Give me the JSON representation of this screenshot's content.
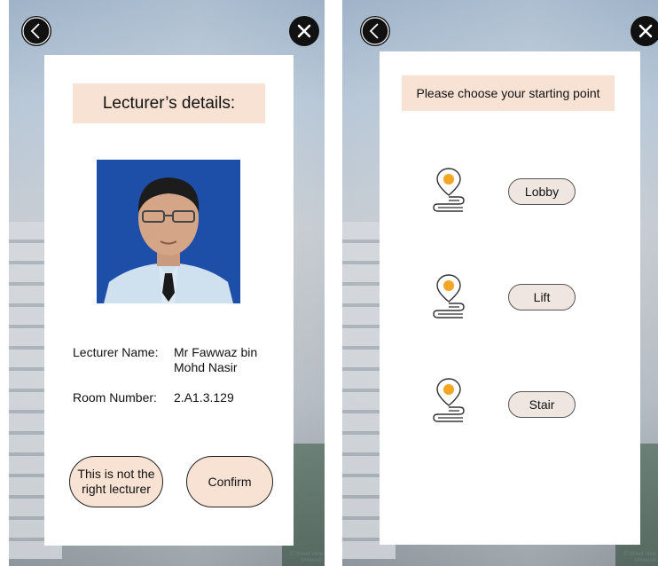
{
  "left_screen": {
    "back_icon": "chevron-left-icon",
    "close_icon": "close-icon",
    "title": "Lecturer’s details:",
    "photo_alt": "lecturer-photo",
    "name_label": "Lecturer Name:",
    "name_value_line1": "Mr Fawwaz bin",
    "name_value_line2": "Mohd Nasir",
    "room_label": "Room Number:",
    "room_value": "2.A1.3.129",
    "not_right_line1": "This is not the",
    "not_right_line2": "right lecturer",
    "confirm_label": "Confirm"
  },
  "right_screen": {
    "back_icon": "chevron-left-icon",
    "close_icon": "close-icon",
    "title": "Please choose your starting point",
    "options": [
      {
        "label": "Lobby",
        "icon": "route-pin-icon"
      },
      {
        "label": "Lift",
        "icon": "route-pin-icon"
      },
      {
        "label": "Stair",
        "icon": "route-pin-icon"
      }
    ]
  },
  "colors": {
    "accent_peach": "#f8e2d3",
    "pin_orange": "#f5a623",
    "photo_background": "#1e4fa8"
  }
}
